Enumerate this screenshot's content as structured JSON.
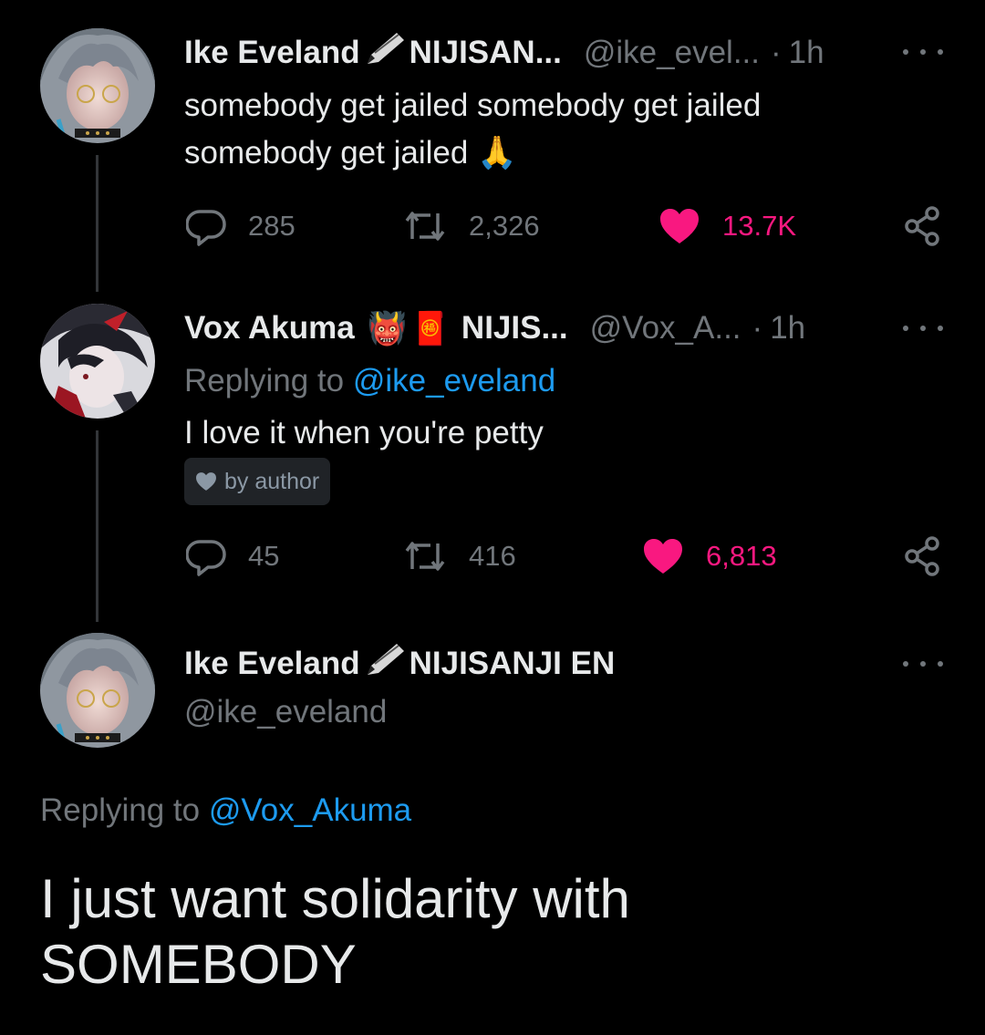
{
  "tweets": [
    {
      "name": "Ike Eveland",
      "affiliation": "NIJISAN...",
      "handle": "@ike_evel...",
      "dot": "·",
      "time": "1h",
      "text_line1": "somebody get jailed somebody get jailed",
      "text_line2": "somebody get jailed",
      "emoji": "🙏",
      "replies": "285",
      "retweets": "2,326",
      "likes": "13.7K"
    },
    {
      "name": "Vox Akuma",
      "emoji1": "👹",
      "emoji2": "🧧",
      "affiliation": "NIJIS...",
      "handle": "@Vox_A...",
      "dot": "·",
      "time": "1h",
      "replying_prefix": "Replying to",
      "replying_handle": "@ike_eveland",
      "text": "I love it when you're petty",
      "liked_by_author": "by author",
      "replies": "45",
      "retweets": "416",
      "likes": "6,813"
    }
  ],
  "main_tweet": {
    "name": "Ike Eveland",
    "affiliation": "NIJISANJI EN",
    "handle": "@ike_eveland",
    "replying_prefix": "Replying to",
    "replying_handle": "@Vox_Akuma",
    "text_line1": "I just want solidarity with",
    "text_line2": "SOMEBODY"
  },
  "colors": {
    "background": "#000000",
    "text": "#e7e9ea",
    "muted": "#71767b",
    "link": "#1d9bf0",
    "like": "#f91880"
  },
  "icons": [
    "reply-icon",
    "retweet-icon",
    "heart-icon",
    "share-icon",
    "more-icon",
    "pen-icon"
  ]
}
